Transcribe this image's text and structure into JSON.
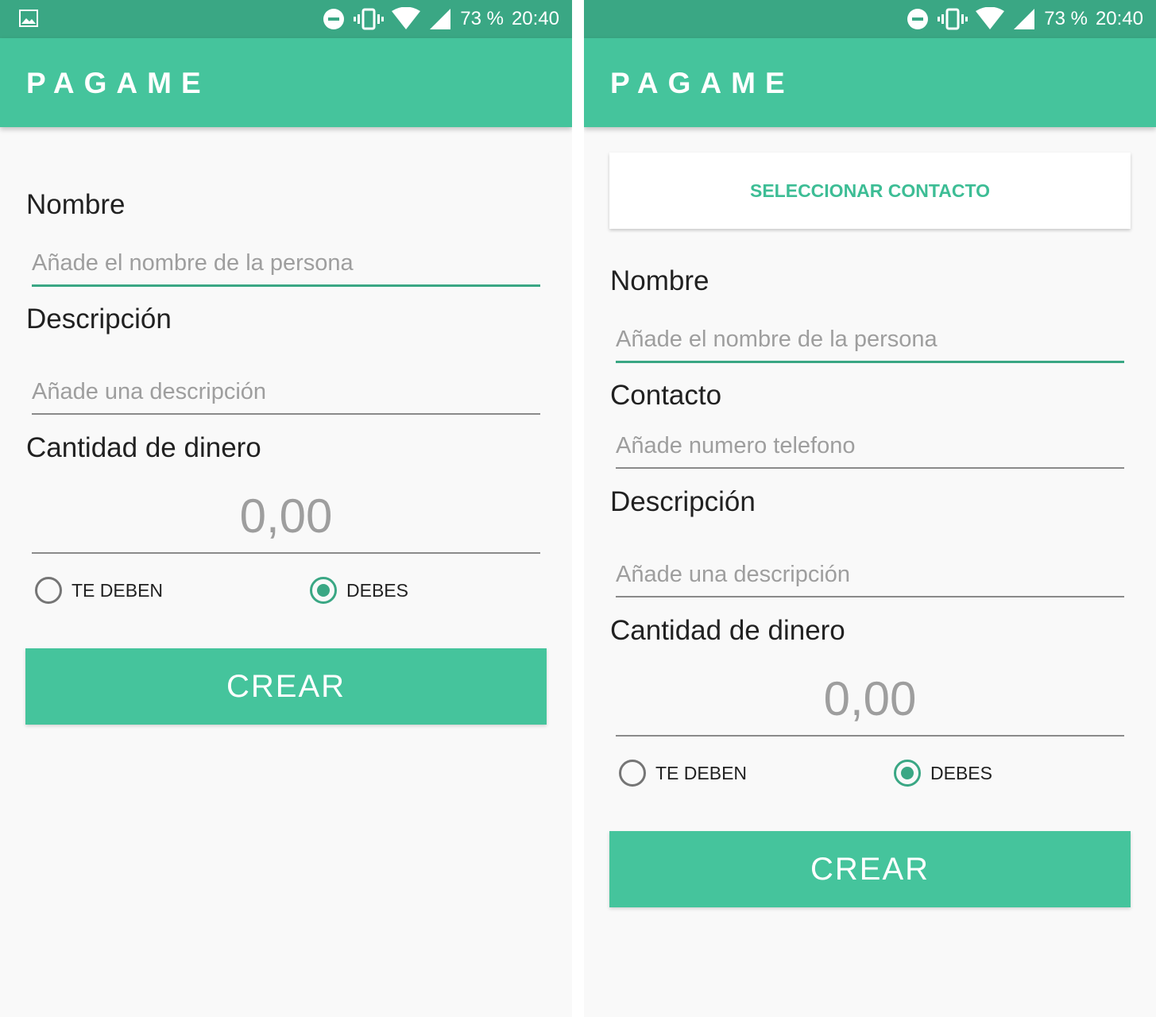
{
  "status_bar": {
    "battery": "73 %",
    "time": "20:40"
  },
  "app_title": "PAGAME",
  "form": {
    "nombre_label": "Nombre",
    "nombre_placeholder": "Añade el nombre de la persona",
    "contacto_label": "Contacto",
    "contacto_placeholder": "Añade numero telefono",
    "descripcion_label": "Descripción",
    "descripcion_placeholder": "Añade una descripción",
    "cantidad_label": "Cantidad de dinero",
    "cantidad_value": "0,00",
    "radio_te_deben": "TE DEBEN",
    "radio_debes": "DEBES",
    "selected_option": "DEBES",
    "crear_button": "CREAR",
    "select_contact_button": "SELECCIONAR CONTACTO"
  },
  "colors": {
    "accent": "#45c49c",
    "status_bar": "#3aa784",
    "background": "#f9f9f9"
  },
  "icons": [
    "gallery-icon",
    "do-not-disturb-icon",
    "vibrate-icon",
    "wifi-icon",
    "cell-signal-icon"
  ]
}
